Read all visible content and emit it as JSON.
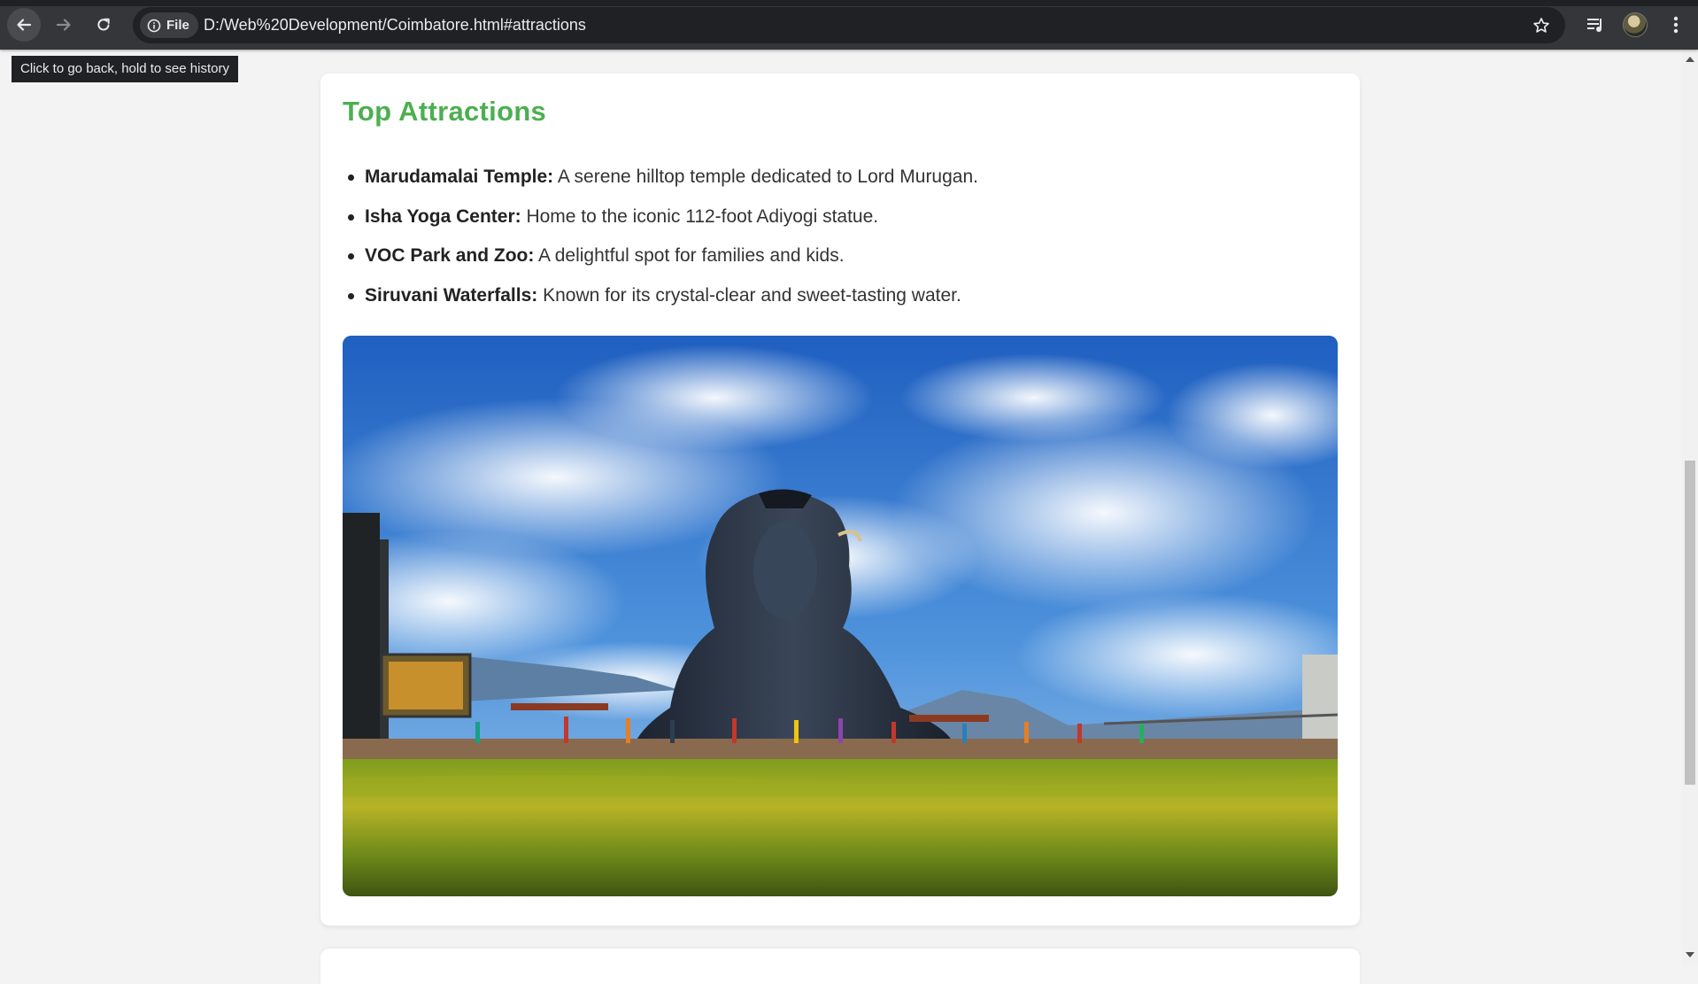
{
  "browser": {
    "site_info_label": "File",
    "url": "D:/Web%20Development/Coimbatore.html#attractions",
    "back_tooltip": "Click to go back, hold to see history",
    "theme_color": "#35363a"
  },
  "section": {
    "heading": "Top Attractions",
    "heading_color": "#4caf50",
    "attractions": [
      {
        "name": "Marudamalai Temple:",
        "description": " A serene hilltop temple dedicated to Lord Murugan."
      },
      {
        "name": "Isha Yoga Center:",
        "description": " Home to the iconic 112-foot Adiyogi statue."
      },
      {
        "name": "VOC Park and Zoo:",
        "description": " A delightful spot for families and kids."
      },
      {
        "name": "Siruvani Waterfalls:",
        "description": " Known for its crystal-clear and sweet-tasting water."
      }
    ],
    "image_subject": "adiyogi-statue-photo"
  },
  "icons": {
    "back": "arrow-left-icon",
    "forward": "arrow-right-icon",
    "reload": "reload-icon",
    "info": "info-icon",
    "bookmark": "star-icon",
    "media": "media-queue-icon",
    "profile": "avatar",
    "menu": "kebab-menu-icon"
  }
}
